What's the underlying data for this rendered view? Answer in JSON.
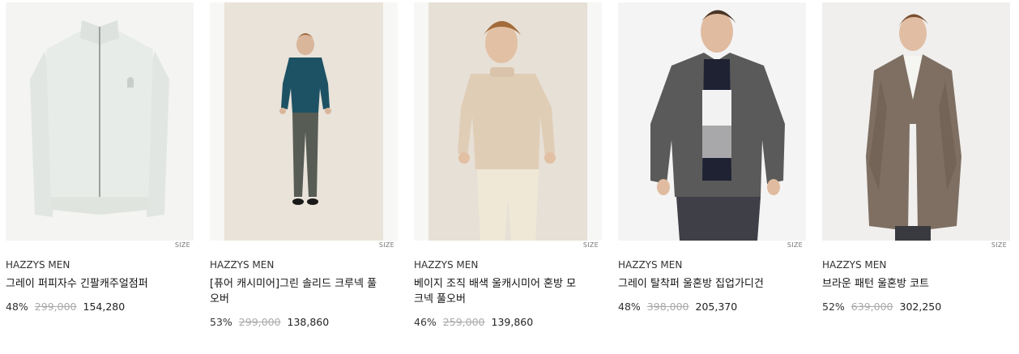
{
  "products": [
    {
      "brand": "HAZZYS MEN",
      "name": "그레이 퍼피자수 긴팔캐주얼점퍼",
      "discount": "48%",
      "original_price": "299,000",
      "sale_price": "154,280",
      "size_label": "SIZE",
      "image_alt": "gray zip-up jacket"
    },
    {
      "brand": "HAZZYS MEN",
      "name": "[퓨어 캐시미어]그린 솔리드 크루넥 풀오버",
      "discount": "53%",
      "original_price": "299,000",
      "sale_price": "138,860",
      "size_label": "SIZE",
      "image_alt": "model in green crewneck sweater"
    },
    {
      "brand": "HAZZYS MEN",
      "name": "베이지 조직 배색 울캐시미어 혼방 모크넥 풀오버",
      "discount": "46%",
      "original_price": "259,000",
      "sale_price": "139,860",
      "size_label": "SIZE",
      "image_alt": "model in beige mock neck sweater"
    },
    {
      "brand": "HAZZYS MEN",
      "name": "그레이 탈착퍼 울혼방 집업가디건",
      "discount": "48%",
      "original_price": "398,000",
      "sale_price": "205,370",
      "size_label": "SIZE",
      "image_alt": "model in gray zip-up cardigan"
    },
    {
      "brand": "HAZZYS MEN",
      "name": "브라운 패턴 울혼방 코트",
      "discount": "52%",
      "original_price": "639,000",
      "sale_price": "302,250",
      "size_label": "SIZE",
      "image_alt": "model in brown herringbone coat"
    }
  ]
}
